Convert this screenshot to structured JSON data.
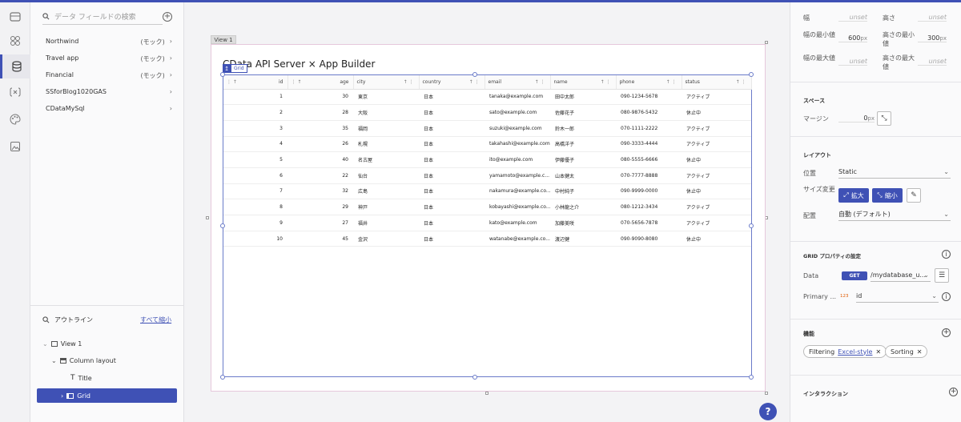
{
  "data_panel": {
    "search_placeholder": "データ フィールドの検索",
    "sources": [
      {
        "name": "Northwind",
        "mock": "(モック)"
      },
      {
        "name": "Travel app",
        "mock": "(モック)"
      },
      {
        "name": "Financial",
        "mock": "(モック)"
      },
      {
        "name": "SSforBlog1020GAS",
        "mock": ""
      },
      {
        "name": "CDataMySql",
        "mock": ""
      }
    ]
  },
  "outline": {
    "title": "アウトライン",
    "collapse_all": "すべて縮小",
    "nodes": [
      "View 1",
      "Column layout",
      "Title",
      "Grid"
    ]
  },
  "canvas": {
    "view_tab": "View 1",
    "page_title": "CData API Server × App Builder",
    "grid_badge": "Grid",
    "columns": [
      "id",
      "age",
      "city",
      "country",
      "email",
      "name",
      "phone",
      "status"
    ],
    "rows": [
      [
        "1",
        "30",
        "東京",
        "日本",
        "tanaka@example.com",
        "田中太郎",
        "090-1234-5678",
        "アクティブ"
      ],
      [
        "2",
        "28",
        "大阪",
        "日本",
        "sato@example.com",
        "佐藤花子",
        "080-9876-5432",
        "休止中"
      ],
      [
        "3",
        "35",
        "福岡",
        "日本",
        "suzuki@example.com",
        "鈴木一郎",
        "070-1111-2222",
        "アクティブ"
      ],
      [
        "4",
        "26",
        "札幌",
        "日本",
        "takahashi@example.com",
        "高橋洋子",
        "090-3333-4444",
        "アクティブ"
      ],
      [
        "5",
        "40",
        "名古屋",
        "日本",
        "ito@example.com",
        "伊藤優子",
        "080-5555-6666",
        "休止中"
      ],
      [
        "6",
        "22",
        "仙台",
        "日本",
        "yamamoto@example.c...",
        "山本健太",
        "070-7777-8888",
        "アクティブ"
      ],
      [
        "7",
        "32",
        "広島",
        "日本",
        "nakamura@example.co...",
        "中村純子",
        "090-9999-0000",
        "休止中"
      ],
      [
        "8",
        "29",
        "神戸",
        "日本",
        "kobayashi@example.co...",
        "小林龍之介",
        "080-1212-3434",
        "アクティブ"
      ],
      [
        "9",
        "27",
        "福井",
        "日本",
        "kato@example.com",
        "加藤美咲",
        "070-5656-7878",
        "アクティブ"
      ],
      [
        "10",
        "45",
        "金沢",
        "日本",
        "watanabe@example.co...",
        "渡辺健",
        "090-9090-8080",
        "休止中"
      ]
    ],
    "help": "?"
  },
  "props": {
    "width_label": "幅",
    "width_value": "unset",
    "height_label": "高さ",
    "height_value": "unset",
    "min_width_label": "幅の最小値",
    "min_width_value": "600",
    "min_width_unit": "px",
    "min_height_label": "高さの最小値",
    "min_height_value": "300",
    "min_height_unit": "px",
    "max_width_label": "幅の最大値",
    "max_width_value": "unset",
    "max_height_label": "高さの最大値",
    "max_height_value": "unset",
    "space_title": "スペース",
    "margin_label": "マージン",
    "margin_value": "0",
    "margin_unit": "px",
    "layout_title": "レイアウト",
    "position_label": "位置",
    "position_value": "Static",
    "resize_label": "サイズ変更",
    "grow_label": "拡大",
    "shrink_label": "縮小",
    "align_label": "配置",
    "align_value": "自動 (デフォルト)",
    "grid_props_title": "GRID プロパティの設定",
    "data_label": "Data",
    "data_method": "GET",
    "data_value": "/mydatabase_u...",
    "primary_label": "Primary ...",
    "primary_type": "123",
    "primary_value": "id",
    "features_title": "機能",
    "filtering_label": "Filtering",
    "filtering_value": "Excel-style",
    "sorting_label": "Sorting",
    "interaction_title": "インタラクション"
  }
}
